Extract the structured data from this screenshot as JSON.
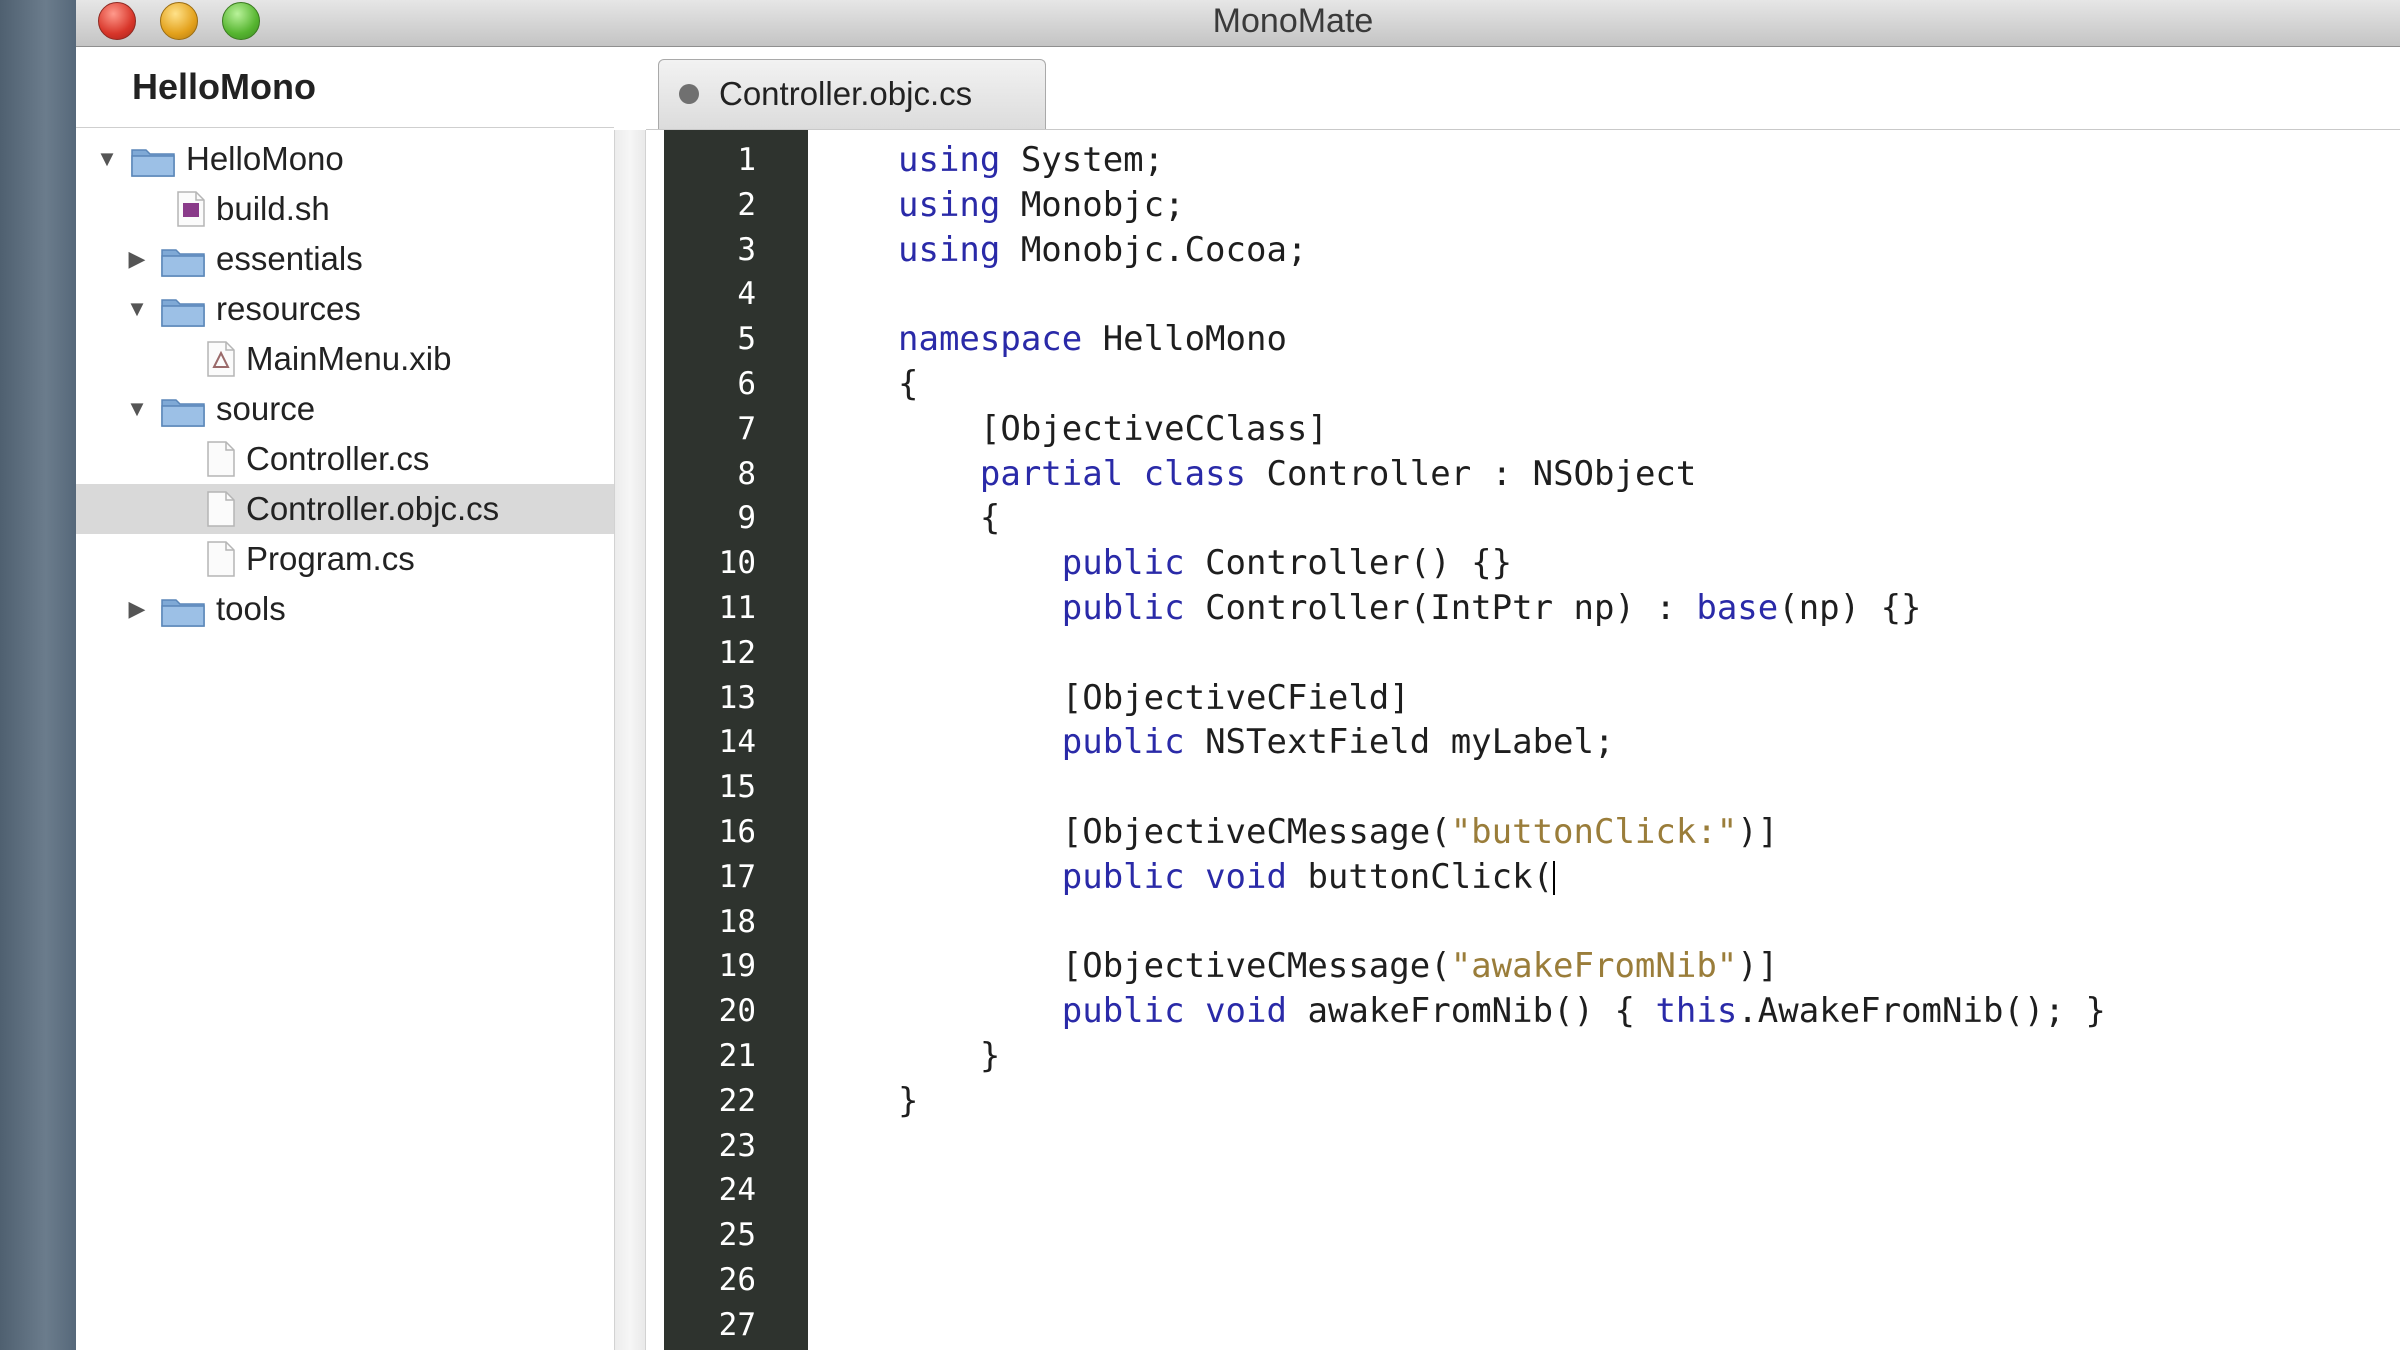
{
  "window": {
    "title": "MonoMate"
  },
  "sidebar": {
    "project_title": "HelloMono",
    "tree": [
      {
        "label": "HelloMono",
        "kind": "folder",
        "state": "expanded",
        "depth": 0,
        "icon": "folder-icon"
      },
      {
        "label": "build.sh",
        "kind": "file",
        "depth": 1,
        "icon": "script-file-icon"
      },
      {
        "label": "essentials",
        "kind": "folder",
        "state": "collapsed",
        "depth": 1,
        "icon": "folder-icon"
      },
      {
        "label": "resources",
        "kind": "folder",
        "state": "expanded",
        "depth": 1,
        "icon": "folder-icon"
      },
      {
        "label": "MainMenu.xib",
        "kind": "file",
        "depth": 2,
        "icon": "xib-file-icon"
      },
      {
        "label": "source",
        "kind": "folder",
        "state": "expanded",
        "depth": 1,
        "icon": "folder-icon"
      },
      {
        "label": "Controller.cs",
        "kind": "file",
        "depth": 2,
        "icon": "document-icon"
      },
      {
        "label": "Controller.objc.cs",
        "kind": "file",
        "depth": 2,
        "icon": "document-icon",
        "selected": true
      },
      {
        "label": "Program.cs",
        "kind": "file",
        "depth": 2,
        "icon": "document-icon"
      },
      {
        "label": "tools",
        "kind": "folder",
        "state": "collapsed",
        "depth": 1,
        "icon": "folder-icon"
      }
    ]
  },
  "tabs": [
    {
      "label": "Controller.objc.cs",
      "active": true,
      "modified_dot": true
    }
  ],
  "editor": {
    "caret_line": 17,
    "line_numbers": [
      "1",
      "2",
      "3",
      "4",
      "5",
      "6",
      "7",
      "8",
      "9",
      "10",
      "11",
      "12",
      "13",
      "14",
      "15",
      "16",
      "17",
      "18",
      "19",
      "20",
      "21",
      "22",
      "23",
      "24",
      "25",
      "26",
      "27"
    ],
    "lines": [
      [
        [
          "kw",
          "using"
        ],
        [
          "t",
          " System;"
        ]
      ],
      [
        [
          "kw",
          "using"
        ],
        [
          "t",
          " Monobjc;"
        ]
      ],
      [
        [
          "kw",
          "using"
        ],
        [
          "t",
          " Monobjc.Cocoa;"
        ]
      ],
      [],
      [
        [
          "kw",
          "namespace"
        ],
        [
          "t",
          " HelloMono"
        ]
      ],
      [
        [
          "t",
          "{"
        ]
      ],
      [
        [
          "t",
          "    [ObjectiveCClass]"
        ]
      ],
      [
        [
          "t",
          "    "
        ],
        [
          "kw",
          "partial"
        ],
        [
          "t",
          " "
        ],
        [
          "kw",
          "class"
        ],
        [
          "t",
          " Controller : NSObject"
        ]
      ],
      [
        [
          "t",
          "    {"
        ]
      ],
      [
        [
          "t",
          "        "
        ],
        [
          "kw",
          "public"
        ],
        [
          "t",
          " Controller() {}"
        ]
      ],
      [
        [
          "t",
          "        "
        ],
        [
          "kw",
          "public"
        ],
        [
          "t",
          " Controller(IntPtr np) : "
        ],
        [
          "kw",
          "base"
        ],
        [
          "t",
          "(np) {}"
        ]
      ],
      [],
      [
        [
          "t",
          "        [ObjectiveCField]"
        ]
      ],
      [
        [
          "t",
          "        "
        ],
        [
          "kw",
          "public"
        ],
        [
          "t",
          " NSTextField myLabel;"
        ]
      ],
      [],
      [
        [
          "t",
          "        [ObjectiveCMessage("
        ],
        [
          "str",
          "\"buttonClick:\""
        ],
        [
          "t",
          ")]"
        ]
      ],
      [
        [
          "t",
          "        "
        ],
        [
          "kw",
          "public"
        ],
        [
          "t",
          " "
        ],
        [
          "kw",
          "void"
        ],
        [
          "t",
          " buttonClick("
        ]
      ],
      [],
      [
        [
          "t",
          "        [ObjectiveCMessage("
        ],
        [
          "str",
          "\"awakeFromNib\""
        ],
        [
          "t",
          ")]"
        ]
      ],
      [
        [
          "t",
          "        "
        ],
        [
          "kw",
          "public"
        ],
        [
          "t",
          " "
        ],
        [
          "kw",
          "void"
        ],
        [
          "t",
          " awakeFromNib() { "
        ],
        [
          "kw",
          "this"
        ],
        [
          "t",
          ".AwakeFromNib(); }"
        ]
      ],
      [
        [
          "t",
          "    }"
        ]
      ],
      [
        [
          "t",
          "}"
        ]
      ],
      [],
      [],
      [],
      [],
      []
    ]
  },
  "colors": {
    "keyword": "#2a2aa8",
    "string": "#9a7d3a",
    "gutter_bg": "#2e332e",
    "selection_bg": "#d9d9d9"
  }
}
